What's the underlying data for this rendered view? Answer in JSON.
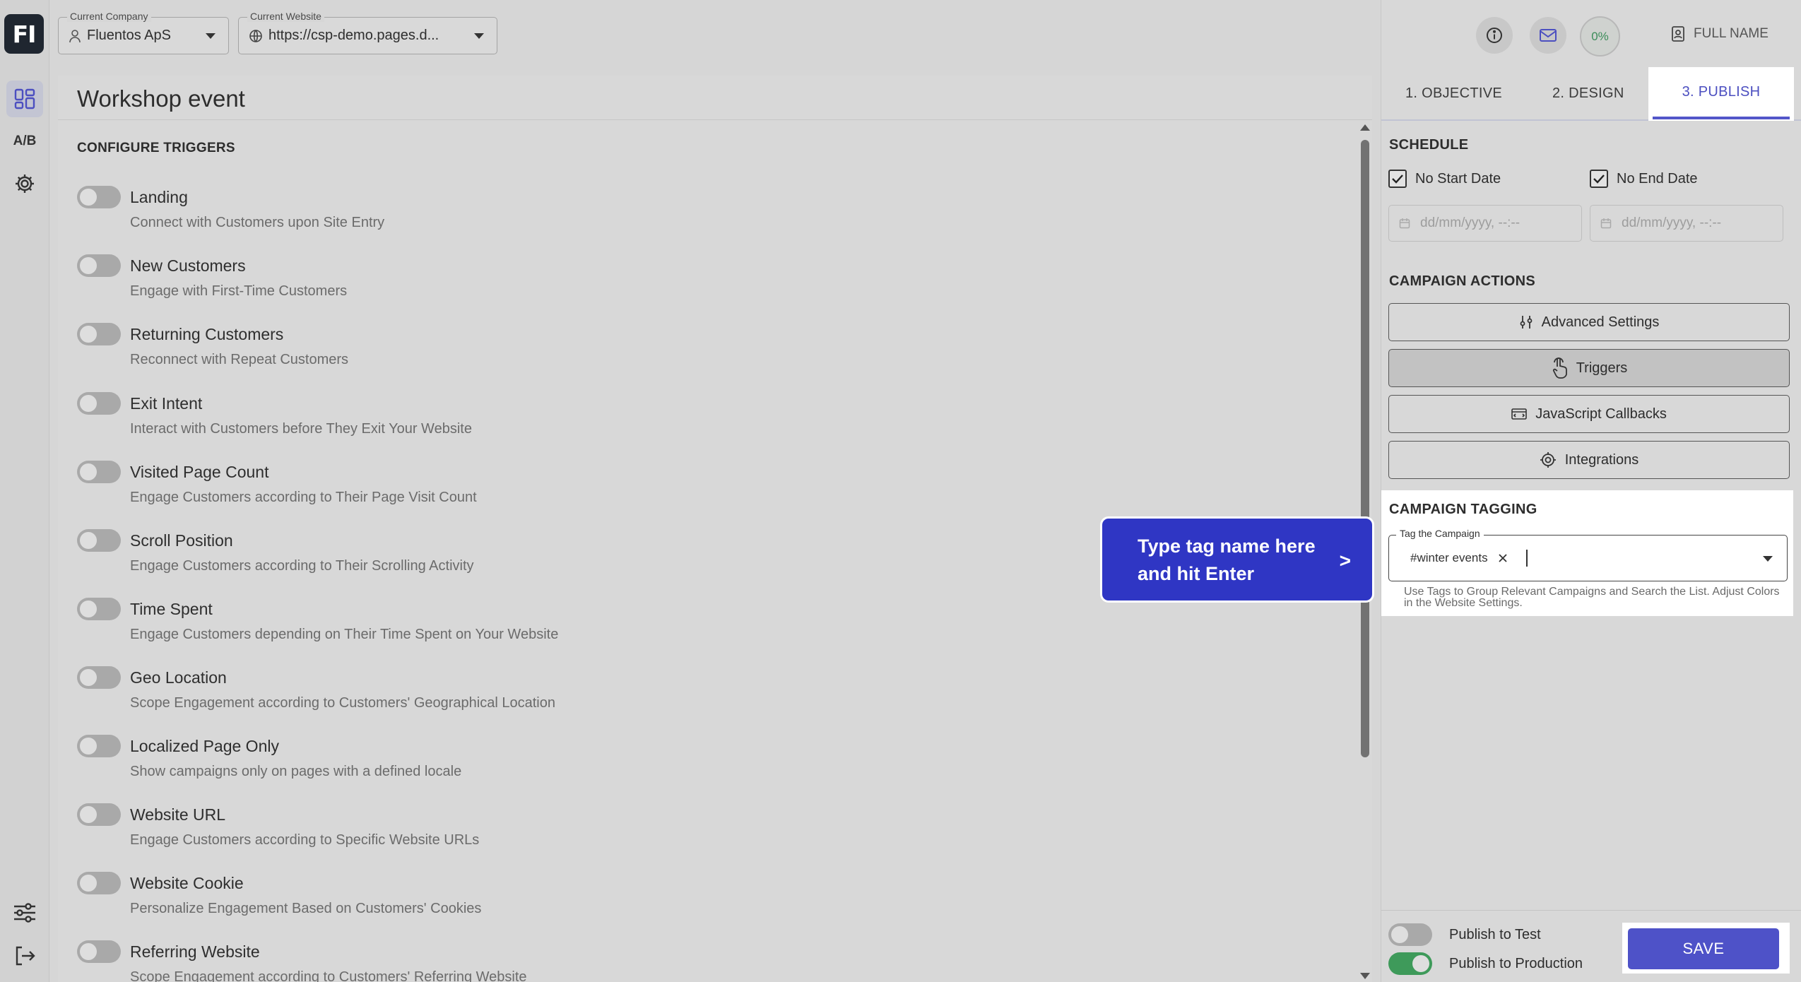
{
  "app": {
    "logo_text": "FI"
  },
  "rail": {
    "items": [
      {
        "name": "dashboard-icon",
        "active": true
      },
      {
        "name": "ab-test",
        "label": "A/B"
      },
      {
        "name": "gear-icon"
      }
    ],
    "bottom": [
      {
        "name": "sliders-icon"
      },
      {
        "name": "logout-icon"
      }
    ]
  },
  "topbar": {
    "company": {
      "label": "Current Company",
      "value": "Fluentos ApS"
    },
    "website": {
      "label": "Current Website",
      "value": "https://csp-demo.pages.d..."
    }
  },
  "header_right": {
    "progress": "0%",
    "user": "FULL NAME"
  },
  "main": {
    "title": "Workshop event",
    "section": "CONFIGURE TRIGGERS",
    "triggers": [
      {
        "name": "Landing",
        "desc": "Connect with Customers upon Site Entry",
        "enabled": false
      },
      {
        "name": "New Customers",
        "desc": "Engage with First-Time Customers",
        "enabled": false
      },
      {
        "name": "Returning Customers",
        "desc": "Reconnect with Repeat Customers",
        "enabled": false
      },
      {
        "name": "Exit Intent",
        "desc": "Interact with Customers before They Exit Your Website",
        "enabled": false
      },
      {
        "name": "Visited Page Count",
        "desc": "Engage Customers according to Their Page Visit Count",
        "enabled": false
      },
      {
        "name": "Scroll Position",
        "desc": "Engage Customers according to Their Scrolling Activity",
        "enabled": false
      },
      {
        "name": "Time Spent",
        "desc": "Engage Customers depending on Their Time Spent on Your Website",
        "enabled": false
      },
      {
        "name": "Geo Location",
        "desc": "Scope Engagement according to Customers' Geographical Location",
        "enabled": false
      },
      {
        "name": "Localized Page Only",
        "desc": "Show campaigns only on pages with a defined locale",
        "enabled": false
      },
      {
        "name": "Website URL",
        "desc": "Engage Customers according to Specific Website URLs",
        "enabled": false
      },
      {
        "name": "Website Cookie",
        "desc": "Personalize Engagement Based on Customers' Cookies",
        "enabled": false
      },
      {
        "name": "Referring Website",
        "desc": "Scope Engagement according to Customers' Referring Website",
        "enabled": false
      }
    ]
  },
  "tooltip": {
    "text": "Type tag name here and hit Enter",
    "arrow": ">"
  },
  "tabs": [
    "1. OBJECTIVE",
    "2. DESIGN",
    "3. PUBLISH"
  ],
  "schedule": {
    "heading": "SCHEDULE",
    "no_start": "No Start Date",
    "no_end": "No End Date",
    "start_placeholder": "dd/mm/yyyy, --:--",
    "end_placeholder": "dd/mm/yyyy, --:--"
  },
  "actions": {
    "heading": "CAMPAIGN ACTIONS",
    "advanced": "Advanced Settings",
    "triggers": "Triggers",
    "js": "JavaScript Callbacks",
    "integrations": "Integrations"
  },
  "tagging": {
    "heading": "CAMPAIGN TAGGING",
    "field_label": "Tag the Campaign",
    "tag": "#winter events",
    "help": "Use Tags to Group Relevant Campaigns and Search the List. Adjust Colors in the Website Settings."
  },
  "publish": {
    "test": "Publish to Test",
    "test_on": false,
    "production": "Publish to Production",
    "production_on": true,
    "save": "SAVE"
  },
  "colors": {
    "accent": "#4e52c8",
    "toggle_on": "#3e9a5a",
    "tooltip": "#2f36c4"
  }
}
